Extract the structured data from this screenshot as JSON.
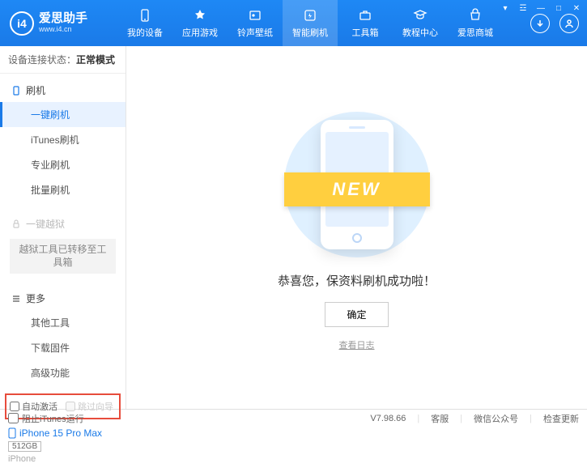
{
  "app": {
    "title": "爱思助手",
    "subtitle": "www.i4.cn"
  },
  "nav": {
    "items": [
      {
        "label": "我的设备"
      },
      {
        "label": "应用游戏"
      },
      {
        "label": "铃声壁纸"
      },
      {
        "label": "智能刷机"
      },
      {
        "label": "工具箱"
      },
      {
        "label": "教程中心"
      },
      {
        "label": "爱思商城"
      }
    ]
  },
  "status": {
    "prefix": "设备连接状态：",
    "value": "正常模式"
  },
  "sidebar": {
    "flash": {
      "head": "刷机",
      "items": [
        "一键刷机",
        "iTunes刷机",
        "专业刷机",
        "批量刷机"
      ]
    },
    "jailbreak": {
      "head": "一键越狱",
      "note": "越狱工具已转移至工具箱"
    },
    "more": {
      "head": "更多",
      "items": [
        "其他工具",
        "下载固件",
        "高级功能"
      ]
    },
    "options": {
      "auto_activate": "自动激活",
      "skip_guide": "跳过向导"
    },
    "device": {
      "name": "iPhone 15 Pro Max",
      "storage": "512GB",
      "type": "iPhone"
    }
  },
  "main": {
    "ribbon": "NEW",
    "message": "恭喜您，保资料刷机成功啦！",
    "ok": "确定",
    "log": "查看日志"
  },
  "footer": {
    "block_itunes": "阻止iTunes运行",
    "version": "V7.98.66",
    "support": "客服",
    "wechat": "微信公众号",
    "update": "检查更新"
  }
}
